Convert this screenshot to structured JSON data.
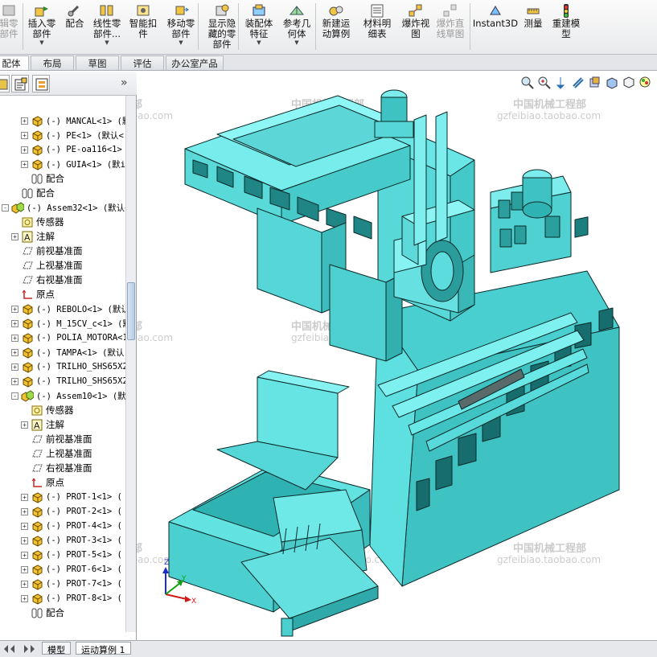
{
  "ribbon": {
    "buttons": [
      {
        "label": "辑零\n部件",
        "dim": true
      },
      {
        "label": "插入零\n部件"
      },
      {
        "label": "配合"
      },
      {
        "label": "线性零\n部件..."
      },
      {
        "label": "智能扣\n件"
      },
      {
        "label": "移动零\n部件"
      },
      {
        "label": "显示隐\n藏的零\n部件"
      },
      {
        "label": "装配体\n特征"
      },
      {
        "label": "参考几\n何体"
      },
      {
        "label": "新建运\n动算例"
      },
      {
        "label": "材料明\n细表"
      },
      {
        "label": "爆炸视\n图"
      },
      {
        "label": "爆炸直\n线草图",
        "dim": true
      },
      {
        "label": "Instant3D"
      },
      {
        "label": "测量"
      },
      {
        "label": "重建模\n型"
      }
    ]
  },
  "command_tabs": [
    "配体",
    "布局",
    "草图",
    "评估",
    "办公室产品"
  ],
  "panel": {
    "collapse_glyph": "»"
  },
  "tree": [
    {
      "text": "(-) MANCAL<1> (默认",
      "level": 2,
      "icon": "part-icon",
      "exp": "+"
    },
    {
      "text": "(-) PE<1> (默认<",
      "level": 2,
      "icon": "part-icon",
      "exp": "+"
    },
    {
      "text": "(-) PE-oa116<1>",
      "level": 2,
      "icon": "part-icon",
      "exp": "+"
    },
    {
      "text": "(-) GUIA<1> (默i",
      "level": 2,
      "icon": "part-icon",
      "exp": "+"
    },
    {
      "text": "配合",
      "level": 2,
      "icon": "mate-icon",
      "exp": "",
      "cn": true
    },
    {
      "text": "配合",
      "level": 1,
      "icon": "mate-icon",
      "exp": "",
      "cn": true
    },
    {
      "text": "(-) Assem32<1> (默认<<",
      "level": 0,
      "icon": "assembly-icon",
      "exp": "-"
    },
    {
      "text": "传感器",
      "level": 1,
      "icon": "sensor-icon",
      "exp": "",
      "cn": true
    },
    {
      "text": "注解",
      "level": 1,
      "icon": "annotation-icon",
      "exp": "+",
      "cn": true
    },
    {
      "text": "前视基准面",
      "level": 1,
      "icon": "plane-icon",
      "exp": "",
      "cn": true
    },
    {
      "text": "上视基准面",
      "level": 1,
      "icon": "plane-icon",
      "exp": "",
      "cn": true
    },
    {
      "text": "右视基准面",
      "level": 1,
      "icon": "plane-icon",
      "exp": "",
      "cn": true
    },
    {
      "text": "原点",
      "level": 1,
      "icon": "origin-icon",
      "exp": "",
      "cn": true
    },
    {
      "text": "(-) REBOLO<1> (默认",
      "level": 1,
      "icon": "part-icon",
      "exp": "+"
    },
    {
      "text": "(-) M_15CV_c<1> (默",
      "level": 1,
      "icon": "part-icon",
      "exp": "+"
    },
    {
      "text": "(-) POLIA_MOTORA<1>",
      "level": 1,
      "icon": "part-icon",
      "exp": "+"
    },
    {
      "text": "(-) TAMPA<1> (默认-",
      "level": 1,
      "icon": "part-icon",
      "exp": "+"
    },
    {
      "text": "(-) TRILHO_SHS65X20",
      "level": 1,
      "icon": "part-icon",
      "exp": "+"
    },
    {
      "text": "(-) TRILHO_SHS65X20",
      "level": 1,
      "icon": "part-icon",
      "exp": "+"
    },
    {
      "text": "(-) Assem10<1> (默i",
      "level": 1,
      "icon": "assembly-icon",
      "exp": "-"
    },
    {
      "text": "传感器",
      "level": 2,
      "icon": "sensor-icon",
      "exp": "",
      "cn": true
    },
    {
      "text": "注解",
      "level": 2,
      "icon": "annotation-icon",
      "exp": "+",
      "cn": true
    },
    {
      "text": "前视基准面",
      "level": 2,
      "icon": "plane-icon",
      "exp": "",
      "cn": true
    },
    {
      "text": "上视基准面",
      "level": 2,
      "icon": "plane-icon",
      "exp": "",
      "cn": true
    },
    {
      "text": "右视基准面",
      "level": 2,
      "icon": "plane-icon",
      "exp": "",
      "cn": true
    },
    {
      "text": "原点",
      "level": 2,
      "icon": "origin-icon",
      "exp": "",
      "cn": true
    },
    {
      "text": "(-) PROT-1<1> (",
      "level": 2,
      "icon": "part-icon",
      "exp": "+"
    },
    {
      "text": "(-) PROT-2<1> (",
      "level": 2,
      "icon": "part-icon",
      "exp": "+"
    },
    {
      "text": "(-) PROT-4<1> (",
      "level": 2,
      "icon": "part-icon",
      "exp": "+"
    },
    {
      "text": "(-) PROT-3<1> (",
      "level": 2,
      "icon": "part-icon",
      "exp": "+"
    },
    {
      "text": "(-) PROT-5<1> (",
      "level": 2,
      "icon": "part-icon",
      "exp": "+"
    },
    {
      "text": "(-) PROT-6<1> (",
      "level": 2,
      "icon": "part-icon",
      "exp": "+"
    },
    {
      "text": "(-) PROT-7<1> (",
      "level": 2,
      "icon": "part-icon",
      "exp": "+"
    },
    {
      "text": "(-) PROT-8<1> (",
      "level": 2,
      "icon": "part-icon",
      "exp": "+"
    },
    {
      "text": "配合",
      "level": 2,
      "icon": "mate-icon",
      "exp": "",
      "cn": true
    }
  ],
  "watermark": {
    "line1": "中国机械工程部",
    "line2": "gzfeibiao.taobao.com"
  },
  "triad": {
    "x": "X",
    "y": "Y",
    "z": "Z"
  },
  "bottom_tabs": [
    "模型",
    "运动算例 1"
  ],
  "colors": {
    "model_fill": "#5fe0e0",
    "model_dark": "#2fb2b2",
    "model_edge": "#0b2a2a",
    "ribbon_bg": "#f0f1f3"
  }
}
